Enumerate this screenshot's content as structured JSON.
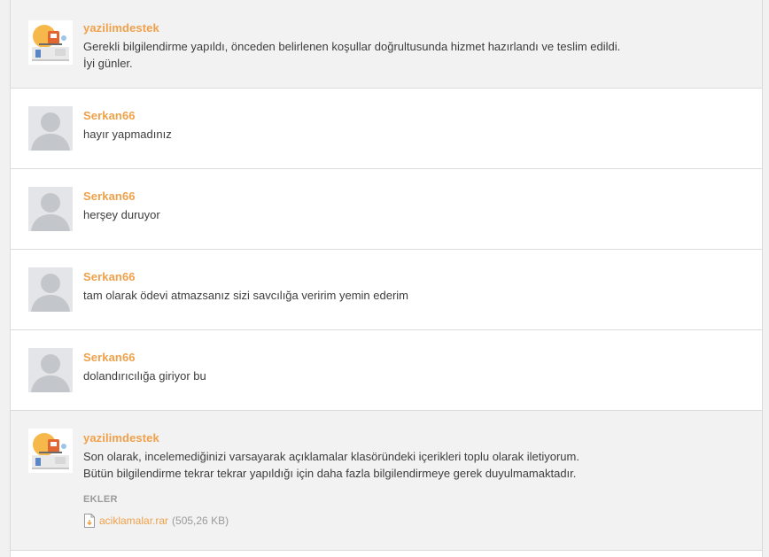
{
  "messages": [
    {
      "author": "yazilimdestek",
      "role": "seller",
      "avatar_icon": "seller-logo-icon",
      "lines": [
        "Gerekli bilgilendirme yapıldı, önceden belirlenen koşullar doğrultusunda hizmet hazırlandı ve teslim edildi.",
        "İyi günler."
      ]
    },
    {
      "author": "Serkan66",
      "role": "buyer",
      "avatar_icon": "default-user-icon",
      "lines": [
        "hayır yapmadınız"
      ]
    },
    {
      "author": "Serkan66",
      "role": "buyer",
      "avatar_icon": "default-user-icon",
      "lines": [
        "herşey duruyor"
      ]
    },
    {
      "author": "Serkan66",
      "role": "buyer",
      "avatar_icon": "default-user-icon",
      "lines": [
        "tam olarak ödevi atmazsanız sizi savcılığa veririm yemin ederim"
      ]
    },
    {
      "author": "Serkan66",
      "role": "buyer",
      "avatar_icon": "default-user-icon",
      "lines": [
        "dolandırıcılığa giriyor bu"
      ]
    },
    {
      "author": "yazilimdestek",
      "role": "seller",
      "avatar_icon": "seller-logo-icon",
      "lines": [
        "Son olarak, incelemediğinizi varsayarak açıklamalar klasöründeki içerikleri toplu olarak iletiyorum.",
        "Bütün bilgilendirme tekrar tekrar yapıldığı için daha fazla bilgilendirmeye gerek duyulmamaktadır."
      ],
      "attachments": {
        "heading": "EKLER",
        "files": [
          {
            "name": "aciklamalar.rar",
            "size": "(505,26 KB)",
            "icon": "file-download-icon"
          }
        ]
      }
    }
  ],
  "colors": {
    "author": "#f0a14a",
    "seller_bg": "#f2f2f2",
    "buyer_bg": "#ffffff",
    "text": "#3d3d3d"
  }
}
